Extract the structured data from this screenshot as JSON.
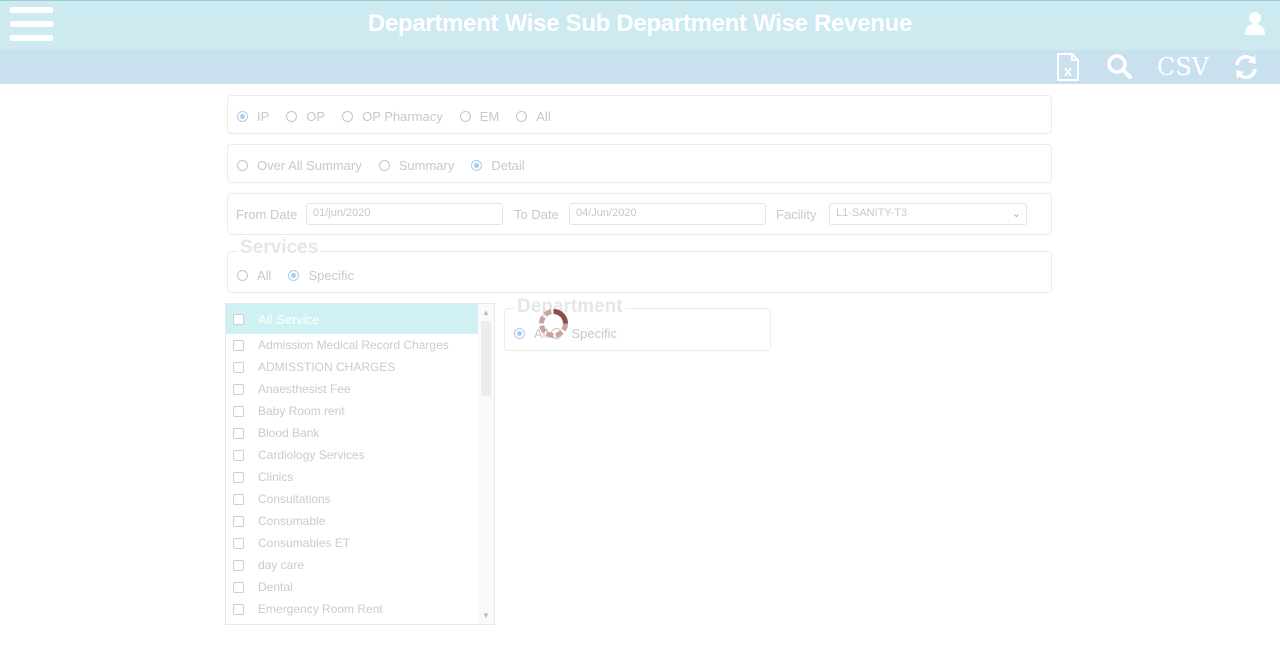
{
  "header": {
    "title": "Department Wise Sub Department Wise Revenue"
  },
  "toolbar": {
    "csv_label": "CSV"
  },
  "patient_type": {
    "options": [
      "IP",
      "OP",
      "OP Pharmacy",
      "EM",
      "All"
    ],
    "selected": "IP"
  },
  "report_type": {
    "options": [
      "Over All Summary",
      "Summary",
      "Detail"
    ],
    "selected": "Detail"
  },
  "filters": {
    "from_date_label": "From Date",
    "from_date_value": "01/jun/2020",
    "to_date_label": "To Date",
    "to_date_value": "04/Jun/2020",
    "facility_label": "Facility",
    "facility_value": "L1-SANITY-T3"
  },
  "services": {
    "legend": "Services",
    "options": [
      "All",
      "Specific"
    ],
    "selected": "Specific",
    "header_label": "All Service",
    "items": [
      "Admission Medical Record Charges",
      "ADMISSTION CHARGES",
      "Anaesthesist Fee",
      "Baby Room rent",
      "Blood Bank",
      "Cardiology Services",
      "Clinics",
      "Consultations",
      "Consumable",
      "Consumables ET",
      "day care",
      "Dental",
      "Emergency Room Rent"
    ]
  },
  "department": {
    "legend": "Department",
    "options": [
      "All",
      "Specific"
    ],
    "selected": "All"
  },
  "colors": {
    "header_bg": "#cdeaf1",
    "toolbar_bg": "#c9e0ef",
    "selected_header_bg": "#cff1f3",
    "radio_accent": "#a9cdef",
    "spinner": "#8f4a4a"
  }
}
